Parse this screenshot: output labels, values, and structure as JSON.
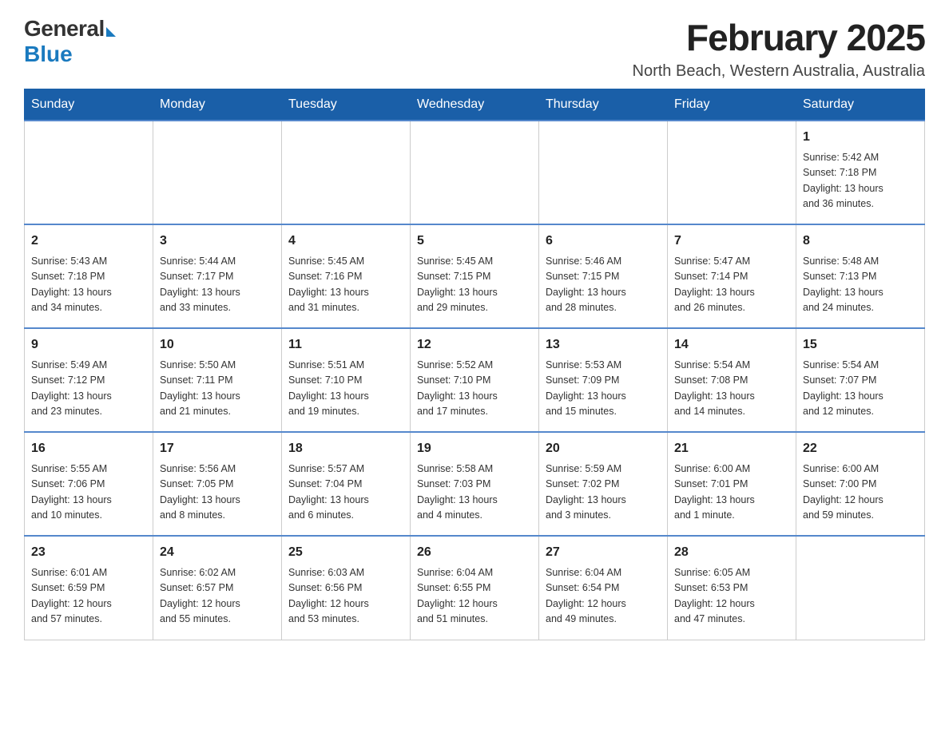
{
  "header": {
    "logo_general": "General",
    "logo_blue": "Blue",
    "title": "February 2025",
    "subtitle": "North Beach, Western Australia, Australia"
  },
  "days_of_week": [
    "Sunday",
    "Monday",
    "Tuesday",
    "Wednesday",
    "Thursday",
    "Friday",
    "Saturday"
  ],
  "weeks": [
    {
      "days": [
        {
          "number": "",
          "info": ""
        },
        {
          "number": "",
          "info": ""
        },
        {
          "number": "",
          "info": ""
        },
        {
          "number": "",
          "info": ""
        },
        {
          "number": "",
          "info": ""
        },
        {
          "number": "",
          "info": ""
        },
        {
          "number": "1",
          "info": "Sunrise: 5:42 AM\nSunset: 7:18 PM\nDaylight: 13 hours\nand 36 minutes."
        }
      ]
    },
    {
      "days": [
        {
          "number": "2",
          "info": "Sunrise: 5:43 AM\nSunset: 7:18 PM\nDaylight: 13 hours\nand 34 minutes."
        },
        {
          "number": "3",
          "info": "Sunrise: 5:44 AM\nSunset: 7:17 PM\nDaylight: 13 hours\nand 33 minutes."
        },
        {
          "number": "4",
          "info": "Sunrise: 5:45 AM\nSunset: 7:16 PM\nDaylight: 13 hours\nand 31 minutes."
        },
        {
          "number": "5",
          "info": "Sunrise: 5:45 AM\nSunset: 7:15 PM\nDaylight: 13 hours\nand 29 minutes."
        },
        {
          "number": "6",
          "info": "Sunrise: 5:46 AM\nSunset: 7:15 PM\nDaylight: 13 hours\nand 28 minutes."
        },
        {
          "number": "7",
          "info": "Sunrise: 5:47 AM\nSunset: 7:14 PM\nDaylight: 13 hours\nand 26 minutes."
        },
        {
          "number": "8",
          "info": "Sunrise: 5:48 AM\nSunset: 7:13 PM\nDaylight: 13 hours\nand 24 minutes."
        }
      ]
    },
    {
      "days": [
        {
          "number": "9",
          "info": "Sunrise: 5:49 AM\nSunset: 7:12 PM\nDaylight: 13 hours\nand 23 minutes."
        },
        {
          "number": "10",
          "info": "Sunrise: 5:50 AM\nSunset: 7:11 PM\nDaylight: 13 hours\nand 21 minutes."
        },
        {
          "number": "11",
          "info": "Sunrise: 5:51 AM\nSunset: 7:10 PM\nDaylight: 13 hours\nand 19 minutes."
        },
        {
          "number": "12",
          "info": "Sunrise: 5:52 AM\nSunset: 7:10 PM\nDaylight: 13 hours\nand 17 minutes."
        },
        {
          "number": "13",
          "info": "Sunrise: 5:53 AM\nSunset: 7:09 PM\nDaylight: 13 hours\nand 15 minutes."
        },
        {
          "number": "14",
          "info": "Sunrise: 5:54 AM\nSunset: 7:08 PM\nDaylight: 13 hours\nand 14 minutes."
        },
        {
          "number": "15",
          "info": "Sunrise: 5:54 AM\nSunset: 7:07 PM\nDaylight: 13 hours\nand 12 minutes."
        }
      ]
    },
    {
      "days": [
        {
          "number": "16",
          "info": "Sunrise: 5:55 AM\nSunset: 7:06 PM\nDaylight: 13 hours\nand 10 minutes."
        },
        {
          "number": "17",
          "info": "Sunrise: 5:56 AM\nSunset: 7:05 PM\nDaylight: 13 hours\nand 8 minutes."
        },
        {
          "number": "18",
          "info": "Sunrise: 5:57 AM\nSunset: 7:04 PM\nDaylight: 13 hours\nand 6 minutes."
        },
        {
          "number": "19",
          "info": "Sunrise: 5:58 AM\nSunset: 7:03 PM\nDaylight: 13 hours\nand 4 minutes."
        },
        {
          "number": "20",
          "info": "Sunrise: 5:59 AM\nSunset: 7:02 PM\nDaylight: 13 hours\nand 3 minutes."
        },
        {
          "number": "21",
          "info": "Sunrise: 6:00 AM\nSunset: 7:01 PM\nDaylight: 13 hours\nand 1 minute."
        },
        {
          "number": "22",
          "info": "Sunrise: 6:00 AM\nSunset: 7:00 PM\nDaylight: 12 hours\nand 59 minutes."
        }
      ]
    },
    {
      "days": [
        {
          "number": "23",
          "info": "Sunrise: 6:01 AM\nSunset: 6:59 PM\nDaylight: 12 hours\nand 57 minutes."
        },
        {
          "number": "24",
          "info": "Sunrise: 6:02 AM\nSunset: 6:57 PM\nDaylight: 12 hours\nand 55 minutes."
        },
        {
          "number": "25",
          "info": "Sunrise: 6:03 AM\nSunset: 6:56 PM\nDaylight: 12 hours\nand 53 minutes."
        },
        {
          "number": "26",
          "info": "Sunrise: 6:04 AM\nSunset: 6:55 PM\nDaylight: 12 hours\nand 51 minutes."
        },
        {
          "number": "27",
          "info": "Sunrise: 6:04 AM\nSunset: 6:54 PM\nDaylight: 12 hours\nand 49 minutes."
        },
        {
          "number": "28",
          "info": "Sunrise: 6:05 AM\nSunset: 6:53 PM\nDaylight: 12 hours\nand 47 minutes."
        },
        {
          "number": "",
          "info": ""
        }
      ]
    }
  ]
}
